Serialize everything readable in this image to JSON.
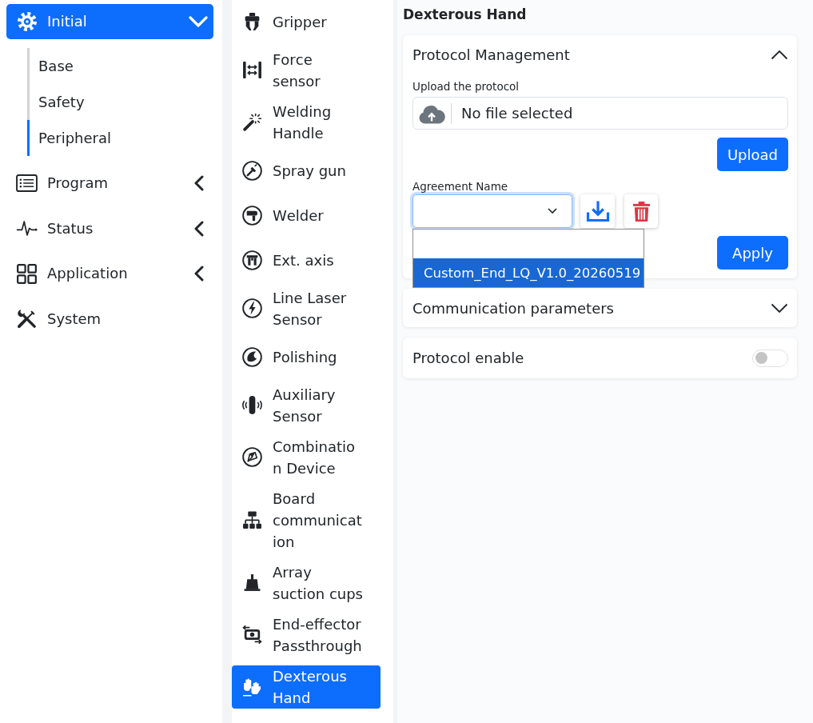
{
  "sidebar": {
    "items": [
      {
        "kind": "group",
        "label": "Initial",
        "selected": true,
        "expanded": true,
        "children": [
          {
            "label": "Base",
            "selected": false
          },
          {
            "label": "Safety",
            "selected": false
          },
          {
            "label": "Peripheral",
            "selected": true
          }
        ]
      },
      {
        "kind": "group",
        "label": "Program",
        "selected": false,
        "expanded": false
      },
      {
        "kind": "group",
        "label": "Status",
        "selected": false,
        "expanded": false
      },
      {
        "kind": "group",
        "label": "Application",
        "selected": false,
        "expanded": false
      },
      {
        "kind": "link",
        "label": "System",
        "selected": false
      }
    ]
  },
  "peripherals": {
    "items": [
      {
        "label": "Gripper",
        "selected": false
      },
      {
        "label": "Force sensor",
        "selected": false
      },
      {
        "label": "Welding Handle",
        "selected": false
      },
      {
        "label": "Spray gun",
        "selected": false
      },
      {
        "label": "Welder",
        "selected": false
      },
      {
        "label": "Ext. axis",
        "selected": false
      },
      {
        "label": "Line Laser Sensor",
        "selected": false
      },
      {
        "label": "Polishing",
        "selected": false
      },
      {
        "label": "Auxiliary Sensor",
        "selected": false
      },
      {
        "label": "Combination Device",
        "selected": false
      },
      {
        "label": "Board communication",
        "selected": false
      },
      {
        "label": "Array suction cups",
        "selected": false
      },
      {
        "label": "End-effector Passthrough",
        "selected": false
      },
      {
        "label": "Dexterous Hand",
        "selected": true
      }
    ]
  },
  "page_title": "Dexterous Hand",
  "panels": [
    {
      "kind": "collapsible",
      "title": "Protocol Management",
      "expanded": true,
      "upload_label": "Upload the protocol",
      "file_status": "No file selected",
      "upload_button": "Upload",
      "agreement_label": "Agreement Name",
      "agreement_select": {
        "open": true,
        "options": [
          {
            "kind": "blank",
            "selected": false
          },
          {
            "kind": "text",
            "label": "Custom_End_LQ_V1.0_20260519",
            "selected": true
          }
        ]
      },
      "apply_button": "Apply"
    },
    {
      "kind": "collapsible",
      "title": "Communication parameters",
      "expanded": false
    },
    {
      "kind": "switch",
      "title": "Protocol enable",
      "on": false
    }
  ]
}
